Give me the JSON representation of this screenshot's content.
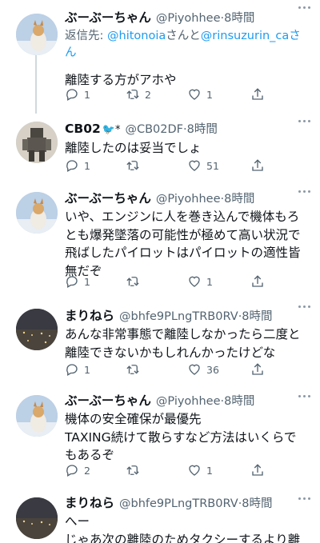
{
  "tweets": [
    {
      "name": "ぶーぶーちゃん",
      "handle": "@Piyohhee",
      "dot": "·",
      "time": "8時間",
      "reply_label": "返信先: ",
      "reply_user1": "@hitonoia",
      "reply_mid": "さんと",
      "reply_user2": "@rinsuzurin_ca",
      "reply_end": "さん",
      "text": "離陸する方がアホや",
      "replies": "1",
      "retweets": "2",
      "likes": "1"
    },
    {
      "name": "CB02",
      "badge": "🐦*",
      "handle": "@CB02DF",
      "dot": "·",
      "time": "8時間",
      "text": "離陸したのは妥当でしょ",
      "replies": "1",
      "retweets": "",
      "likes": "51"
    },
    {
      "name": "ぶーぶーちゃん",
      "handle": "@Piyohhee",
      "dot": "·",
      "time": "8時間",
      "text": "いや、エンジンに人を巻き込んで機体もろ\nとも爆発墜落の可能性が極めて高い状況で\n飛ばしたパイロットはパイロットの適性皆\n無だぞ",
      "replies": "1",
      "retweets": "",
      "likes": "1"
    },
    {
      "name": "まりねら",
      "handle": "@bhfe9PLngTRB0RV",
      "dot": "·",
      "time": "8時間",
      "text": "あんな非常事態で離陸しなかったら二度と\n離陸できないかもしれんかったけどな",
      "replies": "1",
      "retweets": "",
      "likes": "36"
    },
    {
      "name": "ぶーぶーちゃん",
      "handle": "@Piyohhee",
      "dot": "·",
      "time": "8時間",
      "text": "機体の安全確保が最優先\nTAXING続けて散らすなど方法はいくらで\nもあるぞ",
      "replies": "2",
      "retweets": "",
      "likes": "1"
    },
    {
      "name": "まりねら",
      "handle": "@bhfe9PLngTRB0RV",
      "dot": "·",
      "time": "8時間",
      "text": "へー\nじゃあ次の離陸のためタクシーするより離"
    }
  ],
  "icons": {
    "reply": "reply-icon",
    "retweet": "retweet-icon",
    "like": "heart-icon",
    "share": "share-icon",
    "more": "more-icon"
  },
  "colors": {
    "link": "#1d9bf0",
    "muted": "#536471",
    "thread_line": "#cfd9de"
  }
}
